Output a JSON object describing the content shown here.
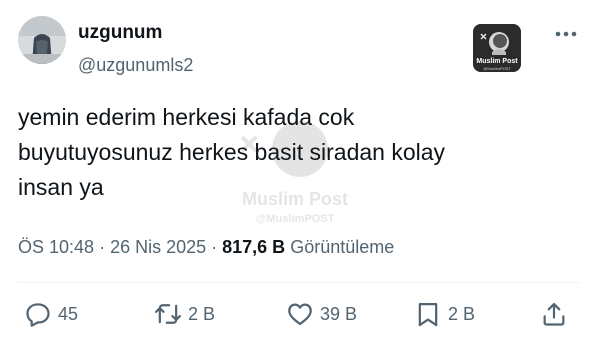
{
  "user": {
    "display_name": "uzgunum",
    "handle": "@uzgunumls2"
  },
  "badge": {
    "label": "Muslim Post",
    "sub": "@MuslimPOST"
  },
  "watermark": {
    "label": "Muslim Post",
    "sub": "@MuslimPOST"
  },
  "tweet": {
    "lines": [
      "yemin ederim herkesi kafada cok",
      "buyutuyosunuz herkes basit siradan kolay",
      "insan ya"
    ]
  },
  "meta": {
    "time": "ÖS 10:48",
    "sep1": " · ",
    "date": "26 Nis 2025",
    "sep2": " · ",
    "views_count": "817,6 B",
    "views_label": " Görüntüleme"
  },
  "actions": {
    "reply": {
      "icon": "reply-icon",
      "count": "45"
    },
    "retweet": {
      "icon": "retweet-icon",
      "count": "2 B"
    },
    "like": {
      "icon": "heart-icon",
      "count": "39 B"
    },
    "bookmark": {
      "icon": "bookmark-icon",
      "count": "2 B"
    },
    "share": {
      "icon": "share-icon"
    }
  },
  "colors": {
    "text_primary": "#0f1419",
    "text_secondary": "#536471",
    "divider": "#eff3f4"
  }
}
